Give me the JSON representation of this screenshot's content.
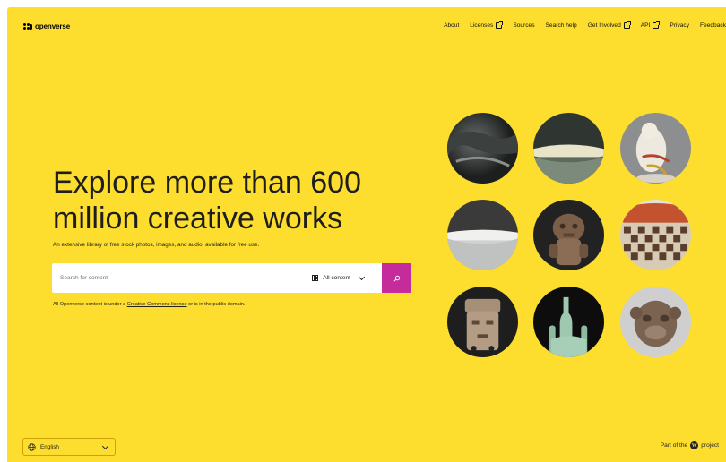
{
  "header": {
    "logo_text": "openverse",
    "nav": [
      {
        "label": "About",
        "external": false
      },
      {
        "label": "Licenses",
        "external": true
      },
      {
        "label": "Sources",
        "external": false
      },
      {
        "label": "Search help",
        "external": false
      },
      {
        "label": "Get Involved",
        "external": true
      },
      {
        "label": "API",
        "external": true
      },
      {
        "label": "Privacy",
        "external": false
      },
      {
        "label": "Feedback",
        "external": false
      }
    ]
  },
  "hero": {
    "headline": "Explore more than 600 million creative works",
    "subheading": "An extensive library of free stock photos, images, and audio, available for free use.",
    "search": {
      "placeholder": "Search for content",
      "content_type": "All content"
    },
    "license_prefix": "All Openverse content is under a ",
    "license_link": "Creative Commons license",
    "license_suffix": " or is in the public domain."
  },
  "footer": {
    "language": "English",
    "part_of_prefix": "Part of the",
    "part_of_suffix": "project"
  },
  "colors": {
    "background": "#FDDD2E",
    "search_button": "#C52B9B"
  },
  "icons": [
    "logo-icon",
    "external-link-icon",
    "content-grid-icon",
    "chevron-down-icon",
    "search-icon",
    "globe-icon",
    "wordpress-icon"
  ]
}
